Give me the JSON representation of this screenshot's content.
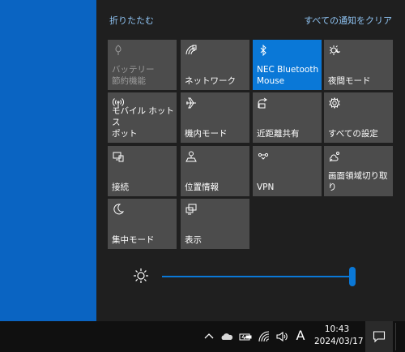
{
  "action_center": {
    "collapse_label": "折りたたむ",
    "clear_all_label": "すべての通知をクリア",
    "tiles": [
      {
        "label": "バッテリー\n節約機能",
        "icon": "battery-saver-icon",
        "state": "disabled"
      },
      {
        "label": "ネットワーク",
        "icon": "network-icon",
        "state": "off"
      },
      {
        "label": "NEC Bluetooth\nMouse",
        "icon": "bluetooth-icon",
        "state": "active"
      },
      {
        "label": "夜間モード",
        "icon": "night-light-icon",
        "state": "off"
      },
      {
        "label": "モバイル ホットス\nポット",
        "icon": "mobile-hotspot-icon",
        "state": "off"
      },
      {
        "label": "機内モード",
        "icon": "airplane-icon",
        "state": "off"
      },
      {
        "label": "近距離共有",
        "icon": "nearby-share-icon",
        "state": "off"
      },
      {
        "label": "すべての設定",
        "icon": "settings-icon",
        "state": "off"
      },
      {
        "label": "接続",
        "icon": "connect-icon",
        "state": "off"
      },
      {
        "label": "位置情報",
        "icon": "location-icon",
        "state": "off"
      },
      {
        "label": "VPN",
        "icon": "vpn-icon",
        "state": "off"
      },
      {
        "label": "画面領域切り取\nり",
        "icon": "screen-snip-icon",
        "state": "off"
      },
      {
        "label": "集中モード",
        "icon": "focus-assist-icon",
        "state": "off"
      },
      {
        "label": "表示",
        "icon": "project-icon",
        "state": "off"
      }
    ],
    "brightness": {
      "icon": "brightness-icon",
      "level": 1.0
    }
  },
  "taskbar": {
    "tray_icons": [
      "chevron-up-icon",
      "onedrive-cloud-icon",
      "battery-icon",
      "wifi-icon",
      "volume-icon"
    ],
    "ime": "A",
    "clock": {
      "time": "10:43",
      "date": "2024/03/17"
    },
    "notification_icon": "notification-icon"
  },
  "colors": {
    "desktop": "#0a64c2",
    "panel": "#1f1f1f",
    "tile": "#4c4c4c",
    "accent": "#0a78d7",
    "link": "#8fc3f2"
  }
}
